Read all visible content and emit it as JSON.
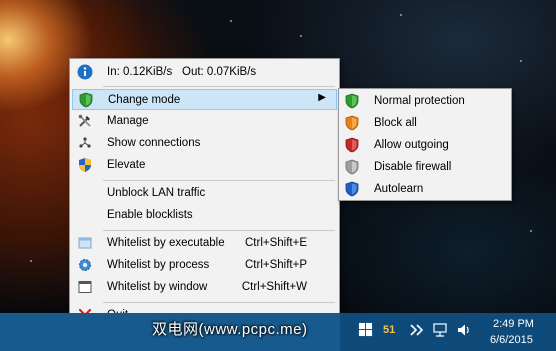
{
  "status": {
    "traffic_in": "In: 0.12KiB/s",
    "traffic_out": "Out: 0.07KiB/s"
  },
  "menu": {
    "change_mode": "Change mode",
    "manage": "Manage",
    "show_connections": "Show connections",
    "elevate": "Elevate",
    "unblock_lan": "Unblock LAN traffic",
    "enable_blocklists": "Enable blocklists",
    "whitelist_executable": "Whitelist by executable",
    "whitelist_executable_sc": "Ctrl+Shift+E",
    "whitelist_process": "Whitelist by process",
    "whitelist_process_sc": "Ctrl+Shift+P",
    "whitelist_window": "Whitelist by window",
    "whitelist_window_sc": "Ctrl+Shift+W",
    "quit": "Quit"
  },
  "submenu": {
    "normal_protection": "Normal protection",
    "block_all": "Block all",
    "allow_outgoing": "Allow outgoing",
    "disable_firewall": "Disable firewall",
    "autolearn": "Autolearn"
  },
  "taskbar": {
    "watermark": "双电网(www.pcpc.me)",
    "tray_badge": "51",
    "time": "2:49 PM",
    "date": "6/6/2015"
  },
  "colors": {
    "shield_green": "#2f9a2f",
    "shield_orange": "#e8801a",
    "shield_red": "#c62828",
    "shield_gray": "#9e9e9e",
    "shield_blue": "#1f5fc4",
    "highlight": "#cde6f7"
  }
}
